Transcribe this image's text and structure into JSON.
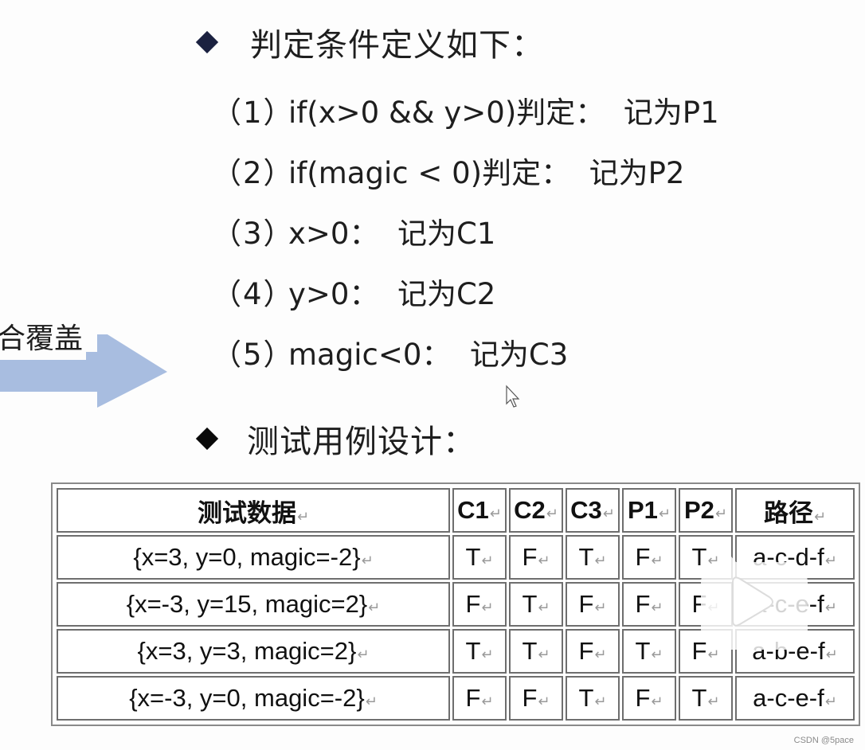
{
  "sections": {
    "conditions_heading": "判定条件定义如下：",
    "test_design_heading": "测试用例设计："
  },
  "conditions": [
    {
      "num": "（1）",
      "text": "if(x>0 && y>0)判定：  记为P1"
    },
    {
      "num": "（2）",
      "text": "if(magic < 0)判定：  记为P2"
    },
    {
      "num": "（3）",
      "text": "x>0：  记为C1"
    },
    {
      "num": "（4）",
      "text": "y>0：  记为C2"
    },
    {
      "num": "（5）",
      "text": "magic<0：  记为C3"
    }
  ],
  "arrow": {
    "label": "合覆盖",
    "color": "#a8bde0"
  },
  "table": {
    "headers": [
      "测试数据",
      "C1",
      "C2",
      "C3",
      "P1",
      "P2",
      "路径"
    ],
    "rows": [
      {
        "data": "{x=3, y=0, magic=-2}",
        "C1": "T",
        "C2": "F",
        "C3": "T",
        "P1": "F",
        "P2": "T",
        "path": "a-c-d-f"
      },
      {
        "data": "{x=-3, y=15, magic=2}",
        "C1": "F",
        "C2": "T",
        "C3": "F",
        "P1": "F",
        "P2": "F",
        "path": "a-c-e-f"
      },
      {
        "data": "{x=3, y=3, magic=2}",
        "C1": "T",
        "C2": "T",
        "C3": "F",
        "P1": "T",
        "P2": "F",
        "path": "a-b-e-f"
      },
      {
        "data": "{x=-3, y=0, magic=-2}",
        "C1": "F",
        "C2": "F",
        "C3": "T",
        "P1": "F",
        "P2": "T",
        "path": "a-c-e-f"
      }
    ],
    "paragraph_mark": "↵"
  },
  "overlay": {
    "icon": "video-play-icon"
  },
  "watermark": "CSDN @5pace"
}
